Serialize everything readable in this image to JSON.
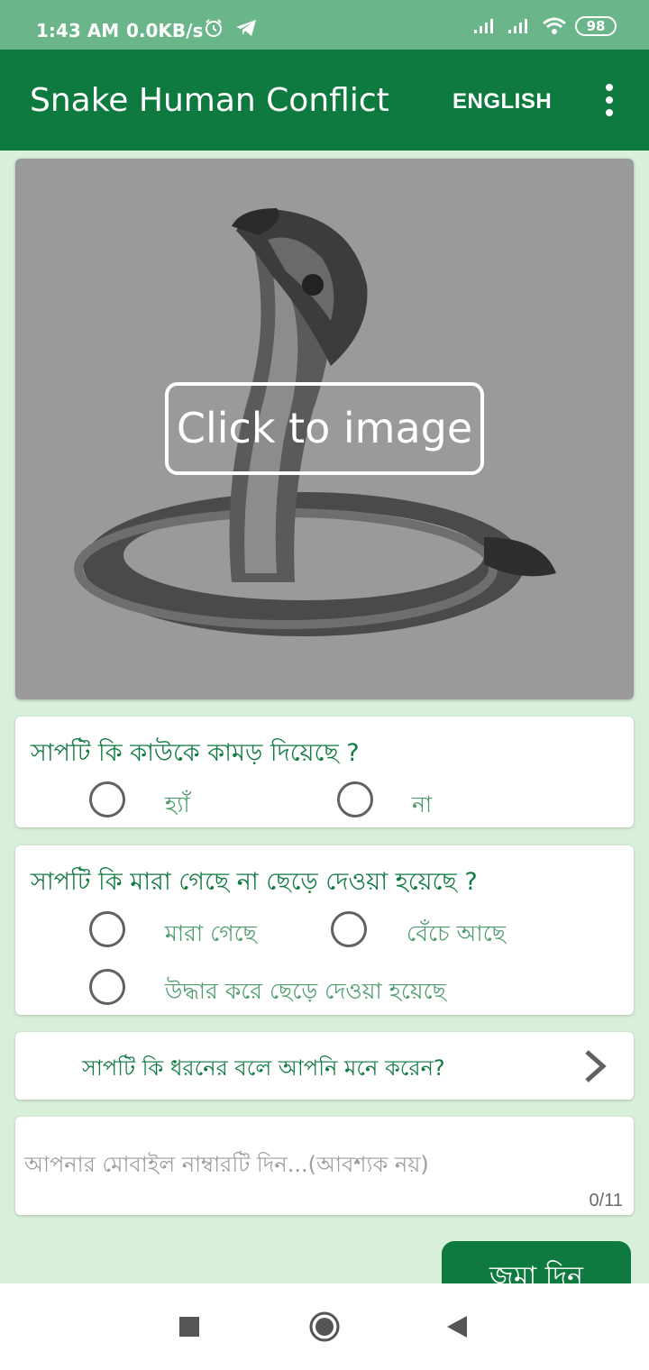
{
  "status_bar": {
    "time": "1:43 AM",
    "network_speed": "0.0KB/s",
    "battery": "98",
    "icons": [
      "alarm-icon",
      "telegram-icon",
      "signal-icon",
      "signal-icon",
      "wifi-icon",
      "battery-icon"
    ]
  },
  "app_bar": {
    "title": "Snake Human Conflict",
    "language_button": "ENGLISH",
    "overflow_icon": "more-vert-icon",
    "color": "#0f7a3f"
  },
  "image_card": {
    "overlay_label": "Click to image",
    "image_subject": "cobra"
  },
  "question_bitten": {
    "text": "সাপটি কি কাউকে কামড় দিয়েছে ?",
    "options": [
      "হ্যাঁ",
      "না"
    ]
  },
  "question_status": {
    "text": "সাপটি কি মারা গেছে না ছেড়ে দেওয়া হয়েছে ?",
    "options": [
      "মারা গেছে",
      "বেঁচে আছে",
      "উদ্ধার করে ছেড়ে দেওয়া হয়েছে"
    ]
  },
  "snake_type": {
    "label": "সাপটি কি ধরনের বলে আপনি মনে করেন?",
    "icon": "chevron-right-icon"
  },
  "mobile_field": {
    "placeholder": "আপনার মোবাইল নাম্বারটি দিন...(আবশ্যক নয়)",
    "counter": "0/11"
  },
  "submit": {
    "label": "জমা দিন"
  },
  "nav_bar": {
    "icons": [
      "recents-square-icon",
      "home-circle-icon",
      "back-triangle-icon"
    ]
  },
  "colors": {
    "primary": "#0f7a3f",
    "status_bar": "#6bb58a",
    "background": "#d8efd9",
    "option_text": "#4f9c6d"
  }
}
